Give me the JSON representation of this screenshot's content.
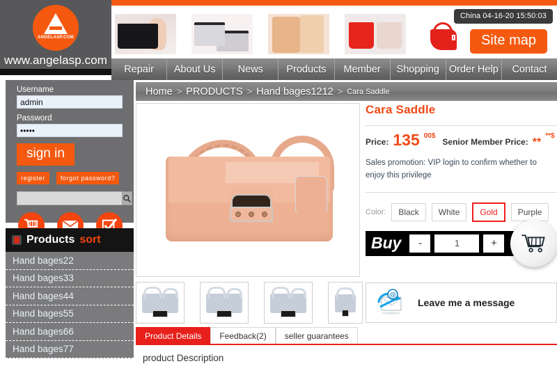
{
  "header": {
    "logo_text": "www.angelasp.com",
    "logo_mark": "ANGELASP.COM",
    "datetime": "China 04-16-20 15:50:03",
    "sitemap_label": "Site map",
    "banner_alts": [
      "black-tote-banner",
      "silver-pouch-banner",
      "tan-bags-banner",
      "red-tote-banner"
    ]
  },
  "nav": {
    "items": [
      {
        "label": "Repair"
      },
      {
        "label": "About Us"
      },
      {
        "label": "News"
      },
      {
        "label": "Products"
      },
      {
        "label": "Member"
      },
      {
        "label": "Shopping"
      },
      {
        "label": "Order Help"
      },
      {
        "label": "Contact"
      }
    ]
  },
  "login": {
    "username_label": "Username",
    "username_value": "admin",
    "password_label": "Password",
    "password_value": "12345",
    "signin_label": "sign in",
    "register_label": "register",
    "forgot_label": "forgot password?",
    "search_value": "",
    "search_placeholder": ""
  },
  "products_sidebar": {
    "title": "Products",
    "title_accent": "sort",
    "items": [
      {
        "label": "Hand bages22"
      },
      {
        "label": "Hand bages33"
      },
      {
        "label": "Hand bages44"
      },
      {
        "label": "Hand bages55"
      },
      {
        "label": "Hand bages66"
      },
      {
        "label": "Hand bages77"
      }
    ]
  },
  "breadcrumb": {
    "home": "Home",
    "sep1": ">",
    "products": "PRODUCTS",
    "sep2": ">",
    "category": "Hand bages1212",
    "sep3": ">",
    "current": "Cara Saddle"
  },
  "product": {
    "title": "Cara Saddle",
    "price_label": "Price:",
    "price_value": "135",
    "price_cents": "00$",
    "member_label": "Senior Member Price:",
    "member_value": "**",
    "member_cents": "**$",
    "promo": "Sales promotion: VIP login to confirm whether to enjoy this privilege",
    "color_label": "Color:",
    "colors": [
      {
        "label": "Black",
        "selected": false
      },
      {
        "label": "White",
        "selected": false
      },
      {
        "label": "Gold",
        "selected": true
      },
      {
        "label": "Purple",
        "selected": false
      }
    ],
    "buy_label": "Buy",
    "minus_label": "-",
    "quantity": "1",
    "plus_label": "+",
    "message_label": "Leave me a message"
  },
  "tabs": {
    "items": [
      {
        "label": "Product Details",
        "active": true
      },
      {
        "label": "Feedback(2)",
        "active": false
      },
      {
        "label": "seller guarantees",
        "active": false
      }
    ],
    "description_heading": "product Description"
  },
  "colors": {
    "orange": "#f4590f",
    "red": "#e8201c",
    "dark": "#141414",
    "sidebar_grey": "#6e6e70",
    "bag_peach": "#eeb193"
  }
}
